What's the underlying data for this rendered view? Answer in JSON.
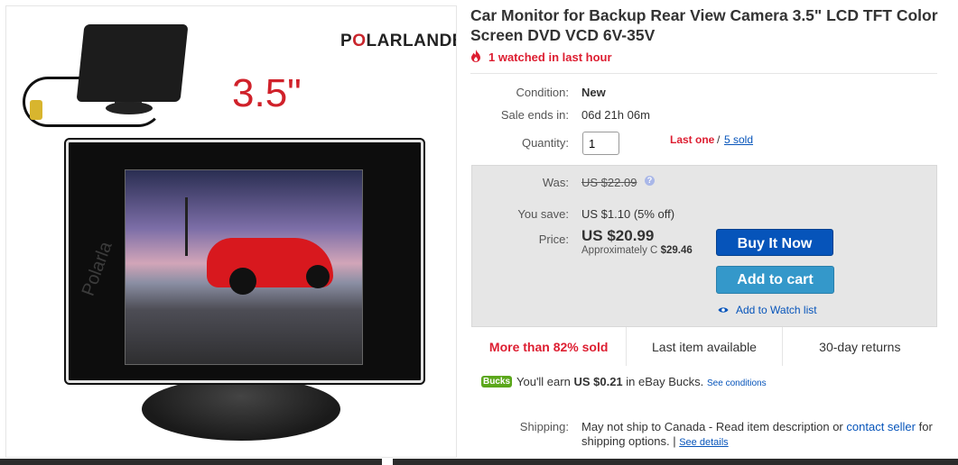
{
  "image": {
    "brand_prefix": "P",
    "brand_o": "O",
    "brand_rest": "LARLANDER",
    "size_label": "3.5\"",
    "watermark": "Polarla"
  },
  "title": "Car Monitor for Backup Rear View Camera 3.5\" LCD TFT Color Screen DVD VCD 6V-35V",
  "watched": "1 watched in last hour",
  "condition": {
    "label": "Condition:",
    "value": "New"
  },
  "sale_ends": {
    "label": "Sale ends in:",
    "value": "06d 21h 06m"
  },
  "quantity": {
    "label": "Quantity:",
    "value": "1",
    "last_one": "Last one",
    "slash": "/",
    "sold_link": "5 sold"
  },
  "pricing": {
    "was_label": "Was:",
    "was_value": "US $22.09",
    "save_label": "You save:",
    "save_value": "US $1.10 (5% off)",
    "price_label": "Price:",
    "price_value": "US $20.99",
    "approx_prefix": "Approximately C",
    "approx_value": "$29.46",
    "buy_now": "Buy It Now",
    "add_to_cart": "Add to cart",
    "add_to_watch": "Add to Watch list"
  },
  "stats": [
    "More than 82% sold",
    "Last item available",
    "30-day returns"
  ],
  "bucks": {
    "logo": "Bucks",
    "text_prefix": "You'll earn",
    "amount": "US $0.21",
    "text_suffix": "in eBay Bucks.",
    "see_conditions": "See conditions"
  },
  "shipping": {
    "label": "Shipping:",
    "text_1": "May not ship to Canada - Read item description or",
    "contact_link": "contact seller",
    "text_2": "for",
    "text_3": "shipping options.",
    "sep": "|",
    "see_details": "See details"
  },
  "colors": {
    "ebay_blue": "#0654ba",
    "cart_blue": "#3498ca",
    "alert_red": "#dd1e31",
    "bucks_green": "#5ba71b"
  }
}
